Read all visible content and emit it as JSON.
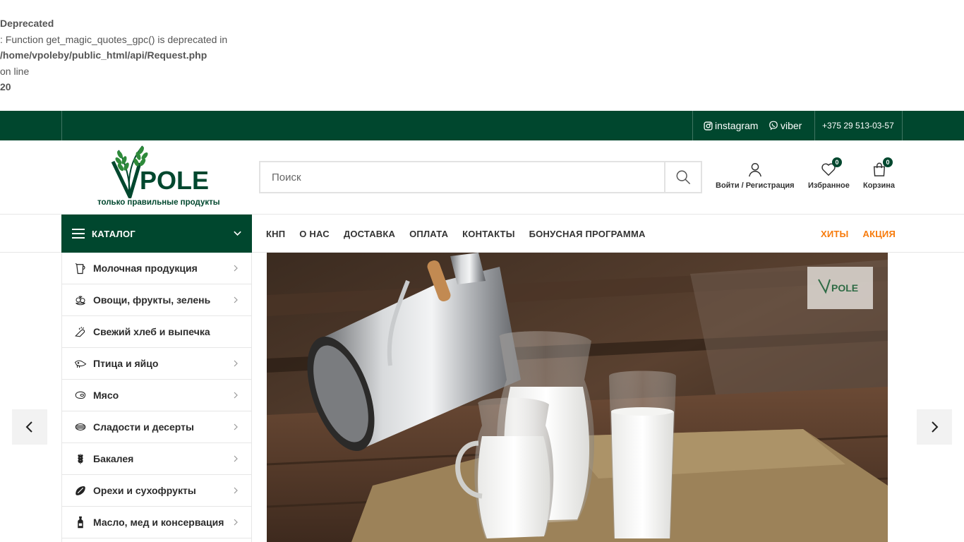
{
  "notice": {
    "label": "Deprecated",
    "message": ": Function get_magic_quotes_gpc() is deprecated in",
    "path": "/home/vpoleby/public_html/api/Request.php",
    "online": "on line",
    "line": "20"
  },
  "topbar": {
    "instagram": "instagram",
    "viber": "viber",
    "phone": "+375 29 513-03-57"
  },
  "logo": {
    "brand": "POLE",
    "tagline": "только правильные продукты"
  },
  "search": {
    "placeholder": "Поиск"
  },
  "header": {
    "account_label": "Войти / Регистрация",
    "wishlist_label": "Избранное",
    "wishlist_count": "0",
    "cart_label": "Корзина",
    "cart_count": "0"
  },
  "catalog": {
    "title": "КАТАЛОГ"
  },
  "menu": {
    "items": [
      "КНП",
      "О НАС",
      "ДОСТАВКА",
      "ОПЛАТА",
      "КОНТАКТЫ",
      "БОНУСНАЯ ПРОГРАММА"
    ],
    "right": [
      "ХИТЫ",
      "АКЦИЯ"
    ]
  },
  "sidebar": {
    "items": [
      {
        "label": "Молочная продукция",
        "icon": "milk-jug-icon"
      },
      {
        "label": "Овощи, фрукты, зелень",
        "icon": "vegetables-icon"
      },
      {
        "label": "Свежий хлеб и выпечка",
        "icon": "bread-icon"
      },
      {
        "label": "Птица и яйцо",
        "icon": "poultry-icon"
      },
      {
        "label": "Мясо",
        "icon": "meat-icon"
      },
      {
        "label": "Сладости и десерты",
        "icon": "dessert-icon"
      },
      {
        "label": "Бакалея",
        "icon": "grain-icon"
      },
      {
        "label": "Орехи и сухофрукты",
        "icon": "nuts-icon"
      },
      {
        "label": "Масло, мед и консервация",
        "icon": "oil-bottle-icon"
      }
    ]
  },
  "colors": {
    "brand_green": "#00472e",
    "accent_orange": "#f77b0c"
  }
}
